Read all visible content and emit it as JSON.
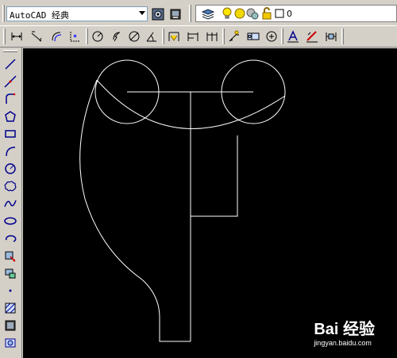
{
  "toolbar": {
    "workspace_value": "AutoCAD 经典",
    "layer_name": "0"
  },
  "icons_row1": [
    "workspace-settings-icon",
    "my-workspace-icon",
    "layer-properties-icon",
    "light-bulb-icon",
    "sun-freeze-icon",
    "lock-icon",
    "color-square-icon"
  ],
  "icons_row2": [
    "linear-dimension-icon",
    "aligned-dimension-icon",
    "arc-length-icon",
    "ordinate-dimension-icon",
    "radius-dimension-icon",
    "jogged-icon",
    "diameter-dimension-icon",
    "angular-dimension-icon",
    "quick-dimension-icon",
    "baseline-dimension-icon",
    "continue-dimension-icon",
    "quick-leader-icon",
    "tolerance-icon",
    "center-mark-icon",
    "dimension-edit-icon",
    "dimension-text-edit-icon",
    "dimension-update-icon"
  ],
  "draw_tools": [
    "line",
    "construction-line",
    "polyline",
    "polygon",
    "rectangle",
    "arc",
    "circle",
    "revision-cloud",
    "spline",
    "ellipse",
    "ellipse-arc",
    "insert-block",
    "make-block",
    "point",
    "hatch",
    "gradient",
    "region"
  ],
  "watermark": {
    "brand": "Bai 经验",
    "url": "jingyan.baidu.com"
  },
  "colors": {
    "canvas_bg": "#000000",
    "stroke": "#ffffff",
    "toolbar_bg": "#d4d0c8"
  }
}
